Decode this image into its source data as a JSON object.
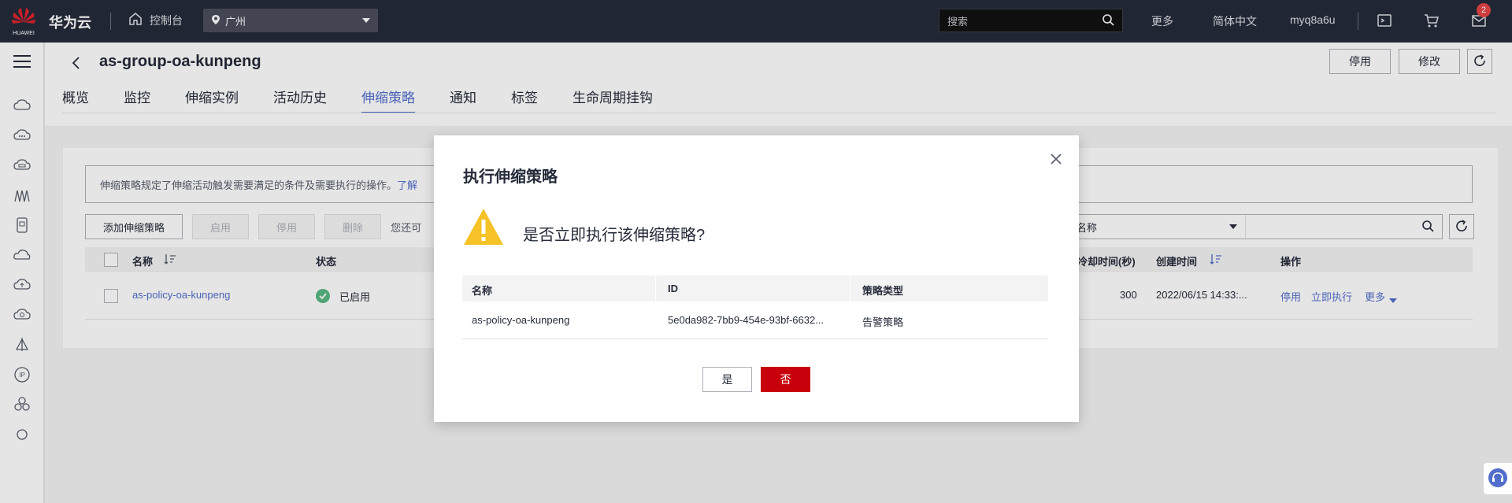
{
  "topbar": {
    "brand": "华为云",
    "logo_text": "HUAWEI",
    "console_label": "控制台",
    "region": "广州",
    "search_placeholder": "搜索",
    "more": "更多",
    "language": "简体中文",
    "username": "myq8a6u",
    "notification_count": "2"
  },
  "header": {
    "title": "as-group-oa-kunpeng",
    "disable_label": "停用",
    "modify_label": "修改",
    "tabs": [
      {
        "label": "概览"
      },
      {
        "label": "监控"
      },
      {
        "label": "伸缩实例"
      },
      {
        "label": "活动历史"
      },
      {
        "label": "伸缩策略"
      },
      {
        "label": "通知"
      },
      {
        "label": "标签"
      },
      {
        "label": "生命周期挂钩"
      }
    ],
    "active_tab": "伸缩策略"
  },
  "policies": {
    "info_text": "伸缩策略规定了伸缩活动触发需要满足的条件及需要执行的操作。",
    "info_link": "了解",
    "add_button": "添加伸缩策略",
    "enable_button": "启用",
    "disable_button": "停用",
    "delete_button": "删除",
    "hint": "您还可",
    "filter_select": "名称",
    "columns": {
      "name": "名称",
      "status": "状态",
      "cooldown": "冷却时间(秒)",
      "created": "创建时间",
      "actions": "操作"
    },
    "rows": [
      {
        "name": "as-policy-oa-kunpeng",
        "status": "已启用",
        "cooldown": "300",
        "created": "2022/06/15 14:33:...",
        "action_disable": "停用",
        "action_execute": "立即执行",
        "action_more": "更多"
      }
    ]
  },
  "modal": {
    "title": "执行伸缩策略",
    "question": "是否立即执行该伸缩策略?",
    "columns": {
      "name": "名称",
      "id": "ID",
      "type": "策略类型"
    },
    "row": {
      "name": "as-policy-oa-kunpeng",
      "id": "5e0da982-7bb9-454e-93bf-6632...",
      "type": "告警策略"
    },
    "yes_label": "是",
    "no_label": "否"
  },
  "colors": {
    "topbar": "#252b3a",
    "accent": "#526ecc",
    "danger": "#c7000b",
    "warning": "#f5c327",
    "success": "#5ab884"
  }
}
